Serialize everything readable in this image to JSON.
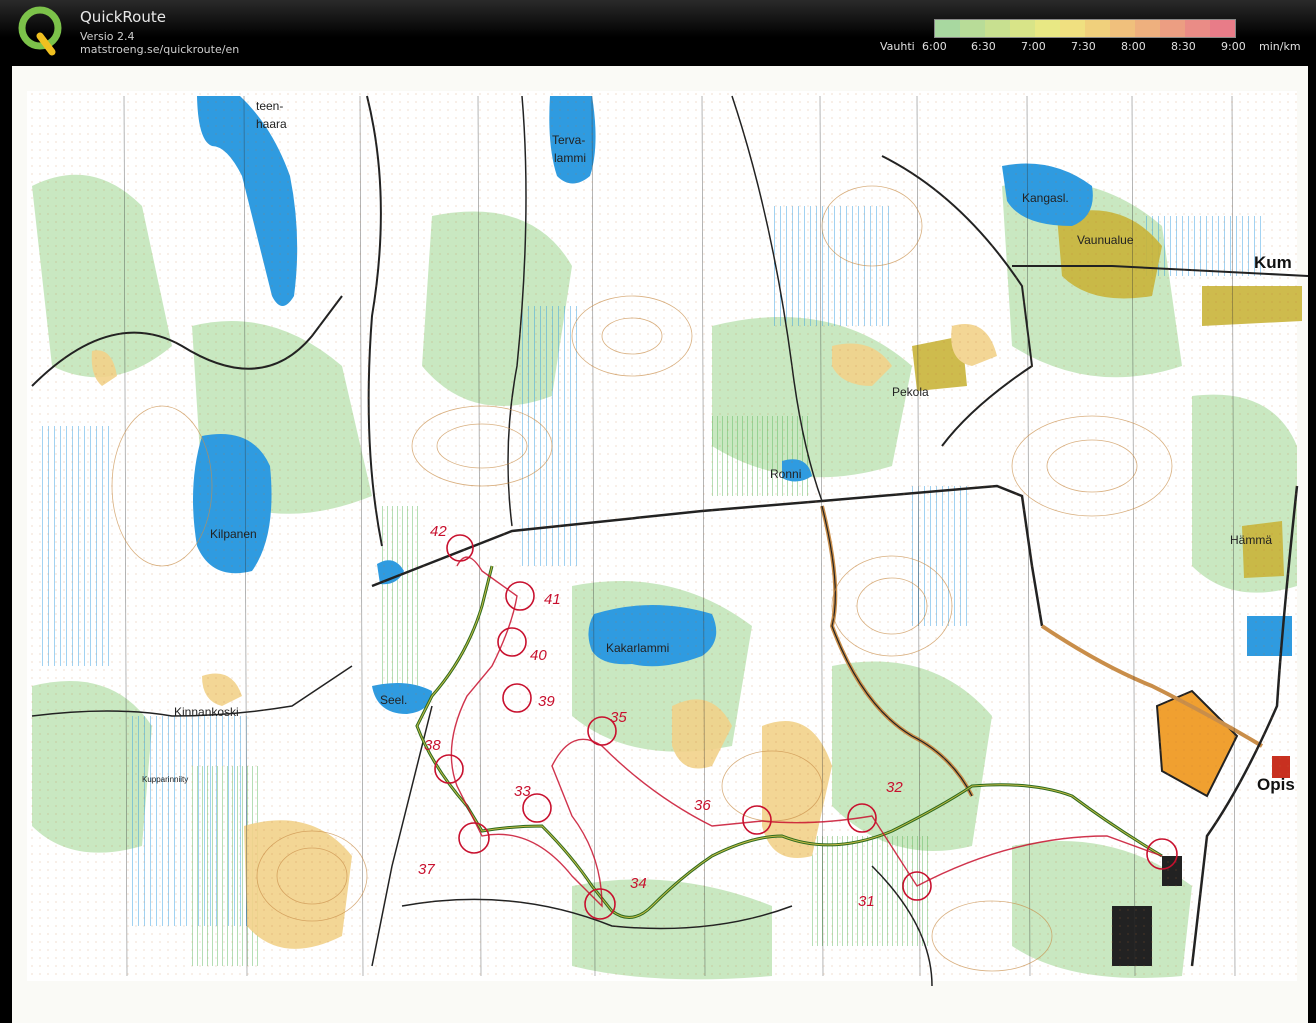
{
  "app": {
    "title": "QuickRoute",
    "version": "Versio 2.4",
    "url": "matstroeng.se/quickroute/en"
  },
  "pace_legend": {
    "prefix": "Vauhti",
    "ticks": [
      "6:00",
      "6:30",
      "7:00",
      "7:30",
      "8:00",
      "8:30",
      "9:00"
    ],
    "unit": "min/km",
    "colors": [
      "#a8d8a0",
      "#b8dc98",
      "#c8e090",
      "#d8e488",
      "#e8e884",
      "#f0e080",
      "#f0d07c",
      "#f0c07c",
      "#eeb07e",
      "#ec9e82",
      "#ea8c86",
      "#e87c88"
    ]
  },
  "map": {
    "place_labels": {
      "teenhaara_1": "teen-",
      "teenhaara_2": "haara",
      "tervalammi_1": "Terva-",
      "tervalammi_2": "lammi",
      "kangasl": "Kangasl.",
      "vaunualue": "Vaunualue",
      "kum": "Kum",
      "pekola": "Pekola",
      "ronni": "Ronni",
      "kilpanen": "Kilpanen",
      "hamma": "Hämmä",
      "kakarlammi": "Kakarlammi",
      "seel": "Seel.",
      "kinnankoski": "Kinnankoski",
      "kupparinniity": "Kupparinniity",
      "opis": "Opis"
    },
    "control_numbers": [
      "42",
      "41",
      "40",
      "39",
      "38",
      "37",
      "36",
      "35",
      "34",
      "33",
      "32",
      "31"
    ],
    "colors": {
      "water": "#2f9be0",
      "green": "#b8e0b0",
      "yellow": "#f2d28a",
      "route": "#2e6b1e",
      "control": "#c8102e"
    }
  }
}
